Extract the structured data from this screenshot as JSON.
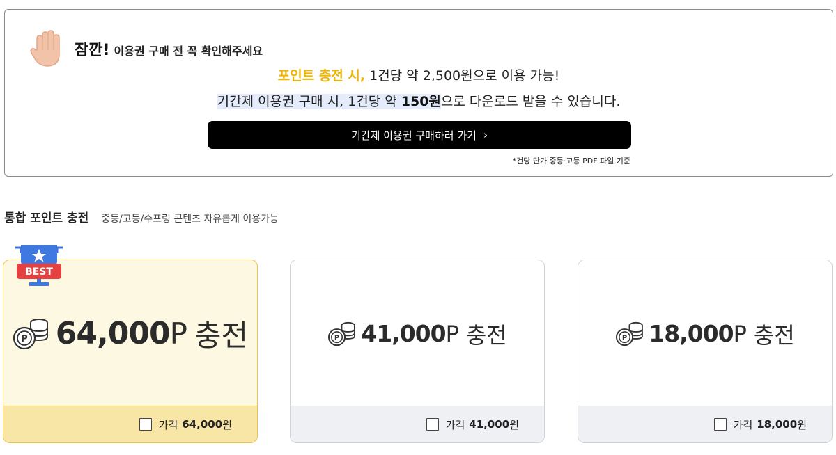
{
  "notice": {
    "title_strong": "잠깐!",
    "title_sub": "이용권 구매 전 꼭 확인해주세요",
    "line1_highlight": "포인트 충전 시,",
    "line1_rest": " 1건당 약 2,500원으로 이용 가능!",
    "line2_part1": "기간제 이용권 구매 시, 1건당 약 ",
    "line2_bold": "150원",
    "line2_part2": "으로 다운로드 받을 수 있습니다.",
    "cta_label": "기간제 이용권 구매하러 가기",
    "cta_chevron": "›",
    "footnote": "*건당 단가 중등·고등 PDF 파일 기준",
    "colors": {
      "highlight": "#f0b400",
      "cta_bg": "#000000"
    },
    "icon": "raised-hand-icon"
  },
  "section": {
    "title": "통합 포인트 충전",
    "description": "중등/고등/수프링 콘텐츠 자유롭게 이용가능"
  },
  "badge": {
    "label": "BEST",
    "icon": "trophy-star-icon"
  },
  "cards": [
    {
      "amount": "64,000",
      "unit": "P",
      "suffix": "충전",
      "price_label": "가격",
      "price": "64,000",
      "price_unit": "원",
      "best": true
    },
    {
      "amount": "41,000",
      "unit": "P",
      "suffix": "충전",
      "price_label": "가격",
      "price": "41,000",
      "price_unit": "원",
      "best": false
    },
    {
      "amount": "18,000",
      "unit": "P",
      "suffix": "충전",
      "price_label": "가격",
      "price": "18,000",
      "price_unit": "원",
      "best": false
    }
  ],
  "coin_icon_letter": "P"
}
